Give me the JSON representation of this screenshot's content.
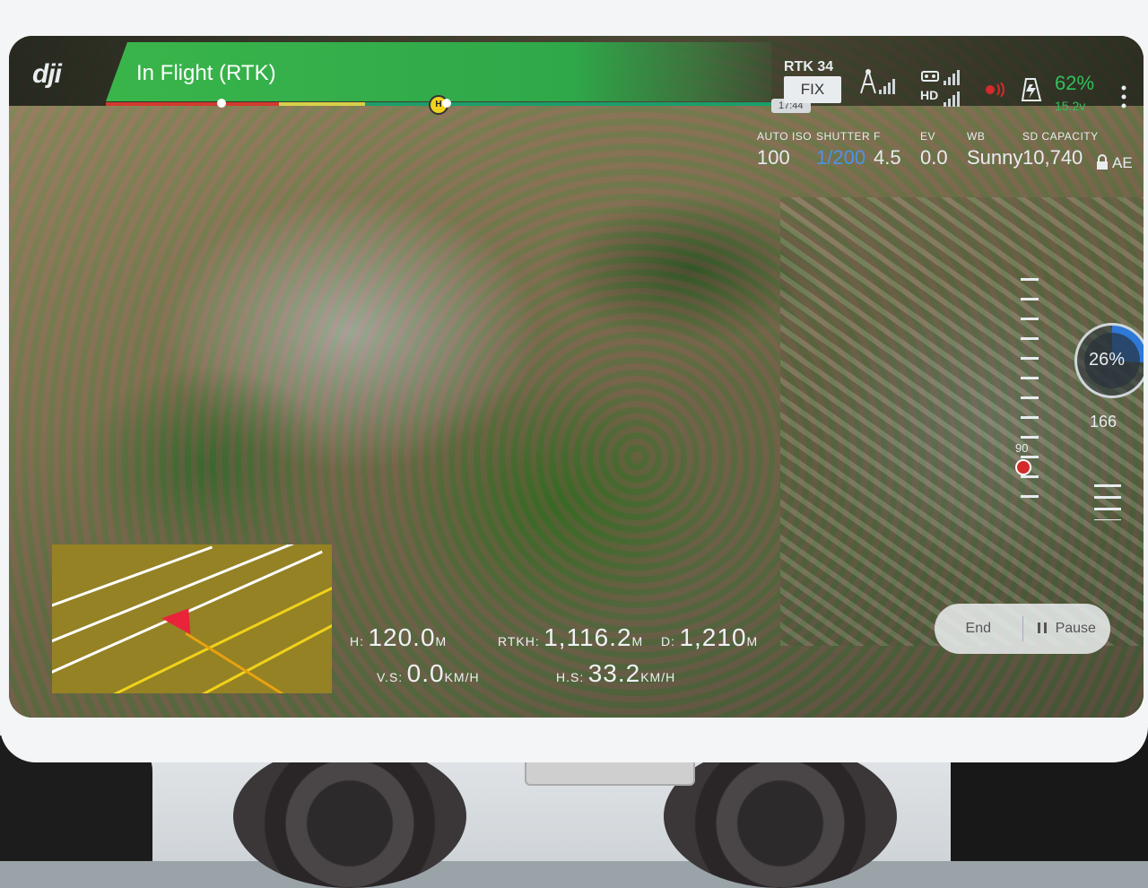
{
  "app": {
    "logo": "dji",
    "flight_status": "In Flight (RTK)",
    "time_remaining": "17:44",
    "home_marker": "H",
    "progress": 0.39
  },
  "status": {
    "rtk_label": "RTK 34",
    "rtk_fix": "FIX",
    "hd_label": "HD",
    "battery_percent": "62%",
    "battery_voltage": "15.2v",
    "colors": {
      "flight_green": "#39b54a",
      "battery_green": "#31c05a",
      "shutter_blue": "#4a93e8",
      "record_red": "#d42a2a"
    }
  },
  "camera": {
    "mode": "AUTO",
    "iso_label": "ISO",
    "iso_value": "100",
    "shutter_label": "SHUTTER",
    "shutter_value": "1/200",
    "f_label": "F",
    "f_value": "4.5",
    "ev_label": "EV",
    "ev_value": "0.0",
    "wb_label": "WB",
    "wb_value": "Sunny",
    "sd_label": "SD CAPACITY",
    "sd_value": "10,740",
    "ae_label": "AE"
  },
  "side": {
    "progress_dial": "26%",
    "count": "166",
    "altitude_marker": "90"
  },
  "actions": {
    "end_label": "End",
    "pause_label": "Pause"
  },
  "telemetry": {
    "h_label": "H:",
    "h_value": "120.0",
    "h_unit": "M",
    "rtkh_label": "RTKH:",
    "rtkh_value": "1,116.2",
    "rtkh_unit": "M",
    "d_label": "D:",
    "d_value": "1,210",
    "d_unit": "M",
    "vs_label": "V.S:",
    "vs_value": "0.0",
    "vs_unit": "KM/H",
    "hs_label": "H.S:",
    "hs_value": "33.2",
    "hs_unit": "KM/H"
  },
  "icons": [
    "dji-logo",
    "rtk-antenna-icon",
    "remote-controller-icon",
    "hd-signal-icon",
    "gps-signal-icon",
    "record-icon",
    "battery-icon",
    "lock-icon",
    "settings-sliders-icon",
    "aircraft-arrow-icon"
  ]
}
